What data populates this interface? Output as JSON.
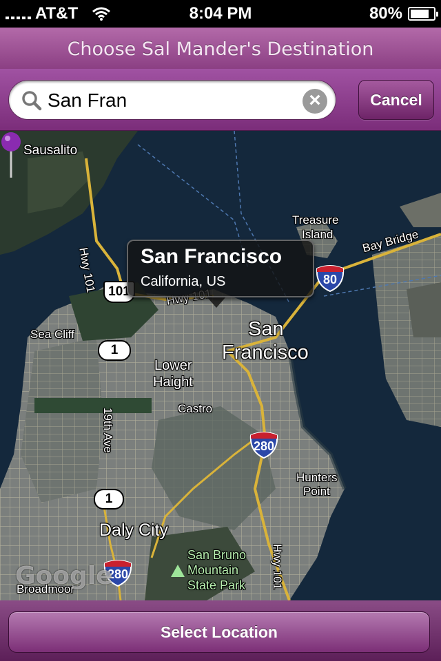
{
  "status_bar": {
    "carrier": "AT&T",
    "time": "8:04 PM",
    "battery": "80%",
    "battery_level": 0.8
  },
  "title": "Choose Sal Mander's Destination",
  "search": {
    "value": "San Fran",
    "placeholder": "",
    "cancel_label": "Cancel"
  },
  "map": {
    "callout_title": "San Francisco",
    "callout_subtitle": "California, US",
    "labels": {
      "sausalito": "Sausalito",
      "treasure_island_1": "Treasure",
      "treasure_island_2": "Island",
      "bay_bridge": "Bay Bridge",
      "hwy101_vertical": "Hwy 101",
      "hwy101_diag": "Hwy 101",
      "sea_cliff": "Sea Cliff",
      "sf_big_1": "San",
      "sf_big_2": "Francisco",
      "lower_haight_1": "Lower",
      "lower_haight_2": "Haight",
      "castro": "Castro",
      "nineteenth_ave": "19th Ave",
      "hunters_point_1": "Hunters",
      "hunters_point_2": "Point",
      "daly_city": "Daly City",
      "san_bruno_1": "San Bruno",
      "san_bruno_2": "Mountain",
      "san_bruno_3": "State Park",
      "hwy101_south": "Hwy 101",
      "broadmoor": "Broadmoor",
      "google": "Google"
    },
    "shields": {
      "us101": "101",
      "ca1_a": "1",
      "ca1_b": "1",
      "i80": "80",
      "i280_a": "280",
      "i280_b": "280"
    }
  },
  "bottom": {
    "select_label": "Select Location"
  },
  "colors": {
    "accent": "#8b3f83",
    "pin": "#8a2bb0"
  }
}
